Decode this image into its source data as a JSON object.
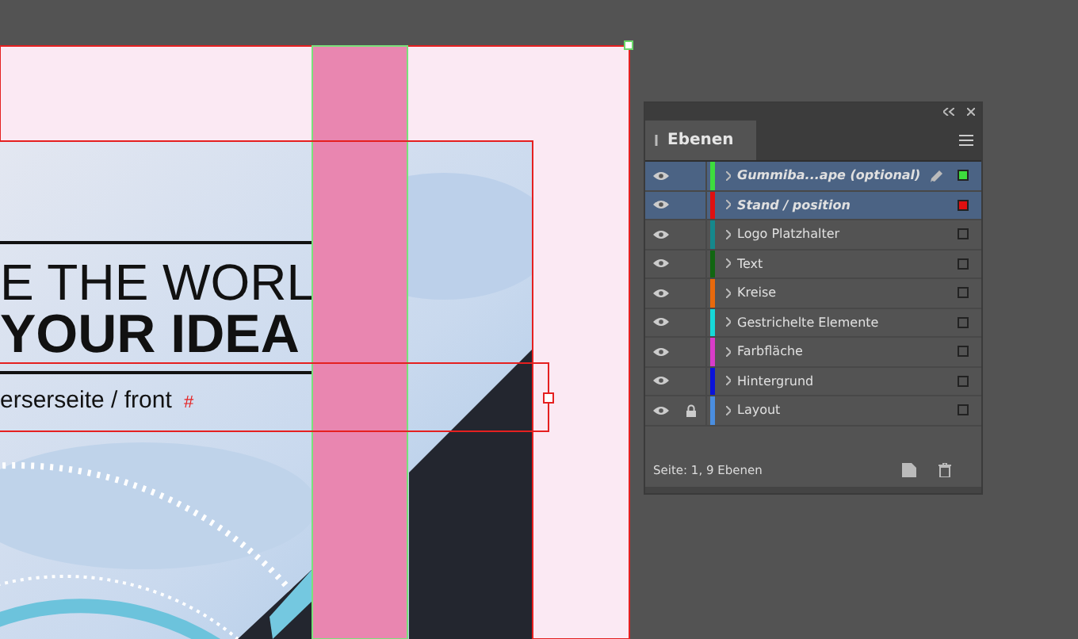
{
  "document": {
    "headline": "E THE WORL",
    "subhead": "YOUR IDEA",
    "caption": "erserseite / front",
    "story_end_marker": "#"
  },
  "layers_panel": {
    "tab": "Ebenen",
    "layers": [
      {
        "name": "Gummiba...ape (optional)",
        "color": "#3ddc3d",
        "selected": true,
        "locked": false,
        "target": true,
        "has_selection": true
      },
      {
        "name": "Stand / position",
        "color": "#e01010",
        "selected": true,
        "locked": false,
        "target": false,
        "has_selection": true
      },
      {
        "name": "Logo Platzhalter",
        "color": "#15888c",
        "selected": false,
        "locked": false,
        "target": false,
        "has_selection": false
      },
      {
        "name": "Text",
        "color": "#116611",
        "selected": false,
        "locked": false,
        "target": false,
        "has_selection": false
      },
      {
        "name": "Kreise",
        "color": "#e8690c",
        "selected": false,
        "locked": false,
        "target": false,
        "has_selection": false
      },
      {
        "name": "Gestrichelte Elemente",
        "color": "#16d8d8",
        "selected": false,
        "locked": false,
        "target": false,
        "has_selection": false
      },
      {
        "name": "Farbfläche",
        "color": "#d83cc8",
        "selected": false,
        "locked": false,
        "target": false,
        "has_selection": false
      },
      {
        "name": "Hintergrund",
        "color": "#0a12d8",
        "selected": false,
        "locked": false,
        "target": false,
        "has_selection": false
      },
      {
        "name": "Layout",
        "color": "#4a8ee0",
        "selected": false,
        "locked": true,
        "target": false,
        "has_selection": false
      }
    ],
    "footer": "Seite: 1, 9 Ebenen"
  }
}
